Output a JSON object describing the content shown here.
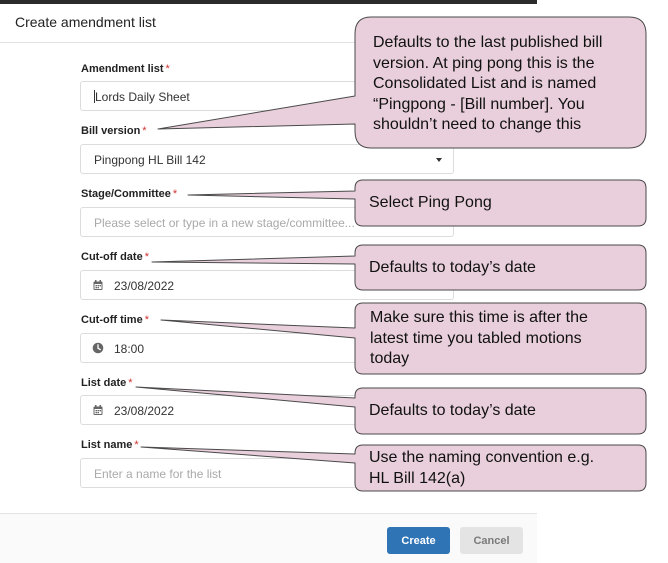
{
  "dialog": {
    "title": "Create amendment list"
  },
  "form": {
    "amendment_list": {
      "label": "Amendment list",
      "value": "Lords Daily Sheet"
    },
    "bill_version": {
      "label": "Bill version",
      "value": "Pingpong HL Bill 142"
    },
    "stage": {
      "label": "Stage/Committee",
      "placeholder": "Please select or type in a new stage/committee..."
    },
    "cutoff_date": {
      "label": "Cut-off date",
      "value": "23/08/2022",
      "icon": "calendar-icon"
    },
    "cutoff_time": {
      "label": "Cut-off time",
      "value": "18:00",
      "icon": "clock-icon"
    },
    "list_date": {
      "label": "List date",
      "value": "23/08/2022",
      "icon": "calendar-icon"
    },
    "list_name": {
      "label": "List name",
      "placeholder": "Enter a name for the list"
    },
    "required_mark": "*"
  },
  "buttons": {
    "create": "Create",
    "cancel": "Cancel"
  },
  "callouts": [
    {
      "lines": [
        "Defaults to the last published bill",
        "version.  At ping pong this is the",
        "Consolidated List and is named",
        "“Pingpong - [Bill number].  You",
        "shouldn’t need to change this"
      ]
    },
    {
      "lines": [
        "Select Ping Pong"
      ]
    },
    {
      "lines": [
        "Defaults to today’s date"
      ]
    },
    {
      "lines": [
        "Make sure this time is after the",
        "latest time you tabled motions",
        "today"
      ]
    },
    {
      "lines": [
        "Defaults to today’s date"
      ]
    },
    {
      "lines": [
        "Use the naming convention e.g.",
        "HL Bill 142(a)"
      ]
    }
  ],
  "colors": {
    "callout_fill": "#e8cfdb",
    "callout_stroke": "#4a4a4a",
    "primary_button": "#2f74b5",
    "required": "#d0312d"
  }
}
